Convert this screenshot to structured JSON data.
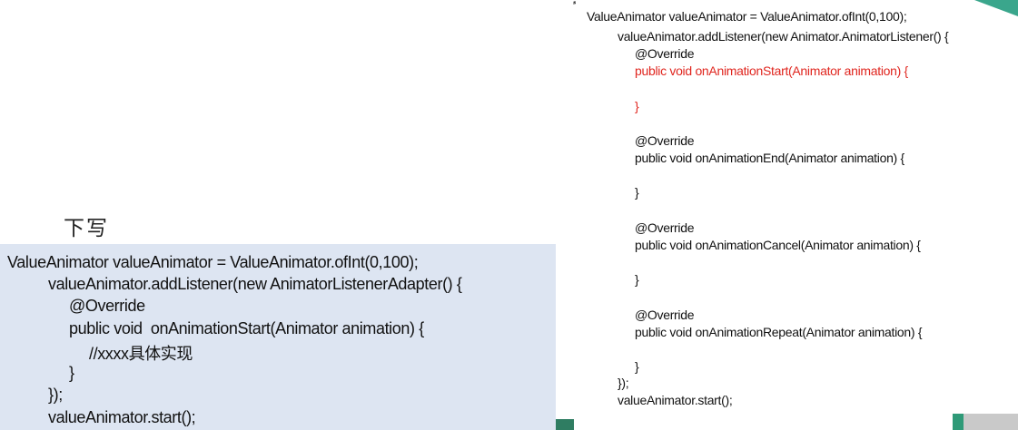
{
  "heading": "下写",
  "left_code": [
    "ValueAnimator valueAnimator = ValueAnimator.ofInt(0,100);",
    "valueAnimator.addListener(new AnimatorListenerAdapter() {",
    "@Override",
    "public void  onAnimationStart(Animator animation) {",
    "//xxxx具体实现",
    "}",
    "});",
    "valueAnimator.start();"
  ],
  "right_code": [
    "ValueAnimator valueAnimator = ValueAnimator.ofInt(0,100);",
    "valueAnimator.addListener(new Animator.AnimatorListener() {",
    "@Override",
    "public void onAnimationStart(Animator animation) {",
    "}",
    "@Override",
    "public void onAnimationEnd(Animator animation) {",
    "}",
    "@Override",
    "public void onAnimationCancel(Animator animation) {",
    "}",
    "@Override",
    "public void onAnimationRepeat(Animator animation) {",
    "}",
    "});",
    "valueAnimator.start();"
  ],
  "colors": {
    "highlight": "#e0261f",
    "left_panel_bg": "#dde5f2",
    "accent": "#2f9a78"
  },
  "icons": {
    "cursor": "mouse-cursor-icon"
  }
}
